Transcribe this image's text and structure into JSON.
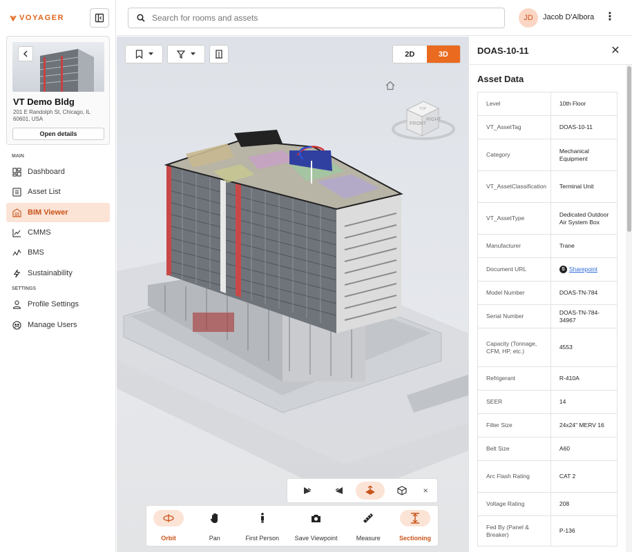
{
  "app": {
    "logo_text": "VOYAGER"
  },
  "building": {
    "name": "VT Demo Bldg",
    "address": "201 E Randolph St, Chicago, IL 60601, USA",
    "open_details_label": "Open details"
  },
  "nav": {
    "main_label": "MAIN",
    "settings_label": "SETTINGS",
    "items": [
      {
        "label": "Dashboard",
        "icon": "dashboard-icon"
      },
      {
        "label": "Asset List",
        "icon": "list-icon"
      },
      {
        "label": "BIM Viewer",
        "icon": "building-icon",
        "active": true
      },
      {
        "label": "CMMS",
        "icon": "chart-icon"
      },
      {
        "label": "BMS",
        "icon": "pulse-icon"
      },
      {
        "label": "Sustainability",
        "icon": "bolt-icon"
      }
    ],
    "settings_items": [
      {
        "label": "Profile Settings",
        "icon": "user-icon"
      },
      {
        "label": "Manage Users",
        "icon": "users-icon"
      }
    ]
  },
  "header": {
    "search_placeholder": "Search for rooms and assets",
    "user_initials": "JD",
    "user_name": "Jacob D'Albora"
  },
  "viewer": {
    "mode_2d": "2D",
    "mode_3d": "3D",
    "active_mode": "3D",
    "viewcube_front": "FRONT",
    "viewcube_right": "RIGHT",
    "viewcube_top": "TOP",
    "tools": [
      {
        "label": "Orbit",
        "icon": "orbit-icon",
        "selected": true
      },
      {
        "label": "Pan",
        "icon": "hand-icon"
      },
      {
        "label": "First Person",
        "icon": "person-icon"
      },
      {
        "label": "Save Viewpoint",
        "icon": "camera-icon"
      },
      {
        "label": "Measure",
        "icon": "ruler-icon"
      },
      {
        "label": "Sectioning",
        "icon": "section-icon",
        "selected": true
      }
    ],
    "section_close": "×"
  },
  "panel": {
    "title": "DOAS-10-11",
    "section_title": "Asset Data",
    "link_badge": "S",
    "rows": [
      {
        "key": "Level",
        "value": "10th Floor"
      },
      {
        "key": "VT_AssetTag",
        "value": "DOAS-10-11"
      },
      {
        "key": "Category",
        "value": "Mechanical Equipment"
      },
      {
        "key": "VT_AssetClassification",
        "value": "Terminal Unit"
      },
      {
        "key": "VT_AssetType",
        "value": "Dedicated Outdoor Air System Box"
      },
      {
        "key": "Manufacturer",
        "value": "Trane"
      },
      {
        "key": "Document URL",
        "value": "Sharepoint",
        "link": true
      },
      {
        "key": "Model Number",
        "value": "DOAS-TN-784"
      },
      {
        "key": "Serial Number",
        "value": "DOAS-TN-784-34967"
      },
      {
        "key": "Capacity (Tonnage, CFM, HP, etc.)",
        "value": "4553"
      },
      {
        "key": "Refrigerant",
        "value": "R-410A"
      },
      {
        "key": "SEER",
        "value": "14"
      },
      {
        "key": "Filter Size",
        "value": "24x24\" MERV 16"
      },
      {
        "key": "Belt Size",
        "value": "A60"
      },
      {
        "key": "Arc Flash Rating",
        "value": "CAT 2"
      },
      {
        "key": "Voltage Rating",
        "value": "208"
      },
      {
        "key": "Fed By (Panel & Breaker)",
        "value": "P-136"
      }
    ]
  },
  "colors": {
    "accent": "#ea6a1f",
    "accent_light": "#fbe3d6"
  }
}
